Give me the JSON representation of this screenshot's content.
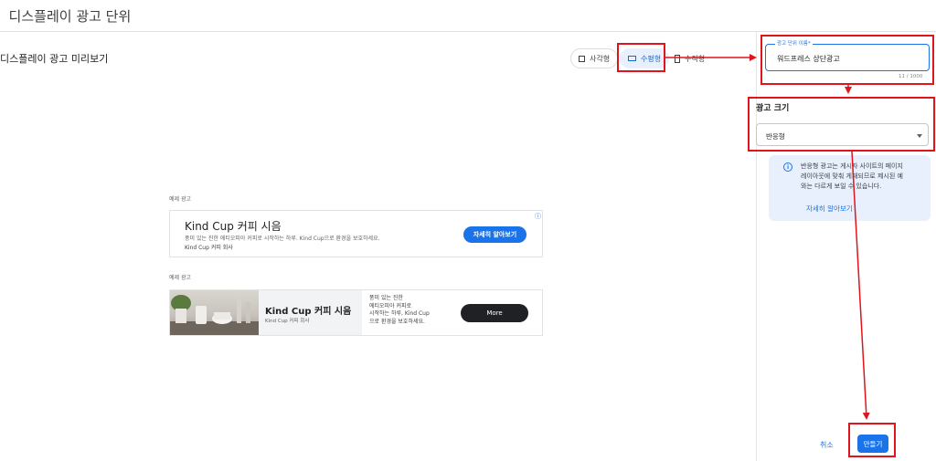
{
  "page": {
    "title": "디스플레이 광고 단위",
    "preview_title": "디스플레이 광고 미리보기"
  },
  "format_chips": [
    {
      "label": "사각형",
      "icon": "square-icon",
      "selected": false
    },
    {
      "label": "수평형",
      "icon": "horizontal-rect-icon",
      "selected": true
    },
    {
      "label": "수직형",
      "icon": "vertical-rect-icon",
      "selected": false
    }
  ],
  "ads": {
    "caption": "예제 광고",
    "ad1": {
      "title": "Kind Cup 커피 시음",
      "description": "풍미 있는 진한 에티오피아 커피로 시작하는 하루. Kind Cup으로 환경을 보호하세요.",
      "advertiser": "Kind Cup 커피 회사",
      "cta": "자세히 알아보기",
      "adchoices": "ⓘ"
    },
    "ad2": {
      "title": "Kind Cup 커피 시음",
      "advertiser": "Kind Cup 커피 회사",
      "body_lines": [
        "풍미 있는 진한",
        "에티오피아 커피로",
        "시작하는 하루, Kind Cup",
        "으로 환경을 보호하세요."
      ],
      "cta": "More"
    }
  },
  "sidebar": {
    "name_field": {
      "label": "광고 단위 이름*",
      "value": "워드프레스 상단광고",
      "counter": "11 / 1000"
    },
    "size": {
      "heading": "광고 크기",
      "selected": "반응형"
    },
    "info": {
      "icon": "info-icon",
      "lines": [
        "반응형 광고는 게시자 사이트의 페이지",
        "레이아웃에 맞춰 게재되므로 제시된 예",
        "와는 다르게 보일 수 있습니다."
      ],
      "link": "자세히 알아보기"
    },
    "actions": {
      "cancel": "취소",
      "create": "만들기"
    }
  },
  "colors": {
    "accent": "#1a73e8",
    "annotation_red": "#e0141c",
    "selected_chip_bg": "#e8f0fe"
  }
}
